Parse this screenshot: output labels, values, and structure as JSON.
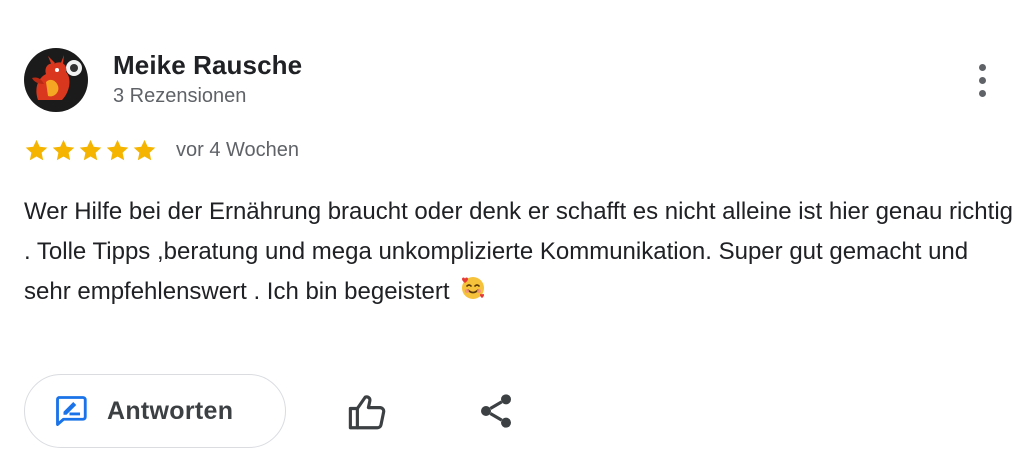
{
  "reviewer": {
    "name": "Meike Rausche",
    "review_count": "3 Rezensionen",
    "avatar_icon": "dragon-avatar"
  },
  "menu": {
    "icon": "more-vertical-icon"
  },
  "review": {
    "rating": 5,
    "max_rating": 5,
    "date": "vor 4 Wochen",
    "text": "Wer Hilfe bei der Ernährung braucht oder denk er schafft es nicht alleine ist hier genau richtig . Tolle Tipps ,beratung und mega unkomplizierte Kommunikation. Super gut gemacht und sehr empfehlenswert . Ich bin begeistert",
    "emoji": "smiling-face-with-hearts"
  },
  "actions": {
    "reply_label": "Antworten",
    "reply_icon": "edit-reply-icon",
    "like_icon": "thumb-up-icon",
    "share_icon": "share-icon"
  },
  "colors": {
    "star": "#F4B400",
    "reply_icon": "#1A73E8",
    "text": "#202124",
    "secondary_text": "#5F6368",
    "button_border": "#DADCE0"
  }
}
